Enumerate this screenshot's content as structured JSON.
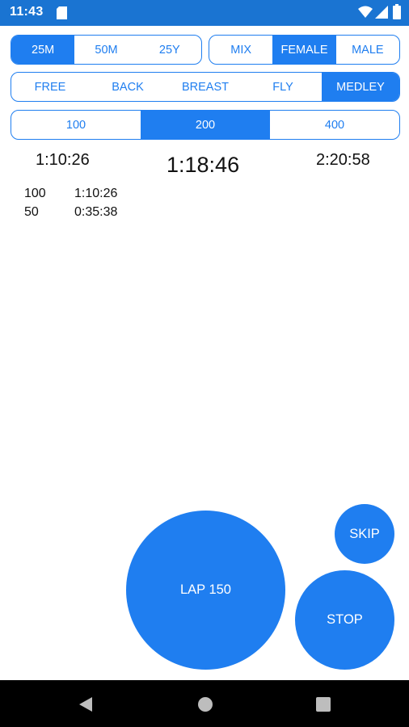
{
  "status_bar": {
    "time": "11:43",
    "icons": [
      "sd-card-icon",
      "wifi-icon",
      "signal-icon",
      "battery-icon"
    ]
  },
  "pool": {
    "options": [
      "25M",
      "50M",
      "25Y"
    ],
    "selected": "25M"
  },
  "gender": {
    "options": [
      "MIX",
      "FEMALE",
      "MALE"
    ],
    "selected": "FEMALE"
  },
  "stroke": {
    "options": [
      "FREE",
      "BACK",
      "BREAST",
      "FLY",
      "MEDLEY"
    ],
    "selected": "MEDLEY"
  },
  "distance": {
    "options": [
      "100",
      "200",
      "400"
    ],
    "selected": "200"
  },
  "times": {
    "left": "1:10:26",
    "main": "1:18:46",
    "right": "2:20:58"
  },
  "splits": [
    {
      "distance": "100",
      "time": "1:10:26"
    },
    {
      "distance": "50",
      "time": "0:35:38"
    }
  ],
  "buttons": {
    "lap": "LAP 150",
    "skip": "SKIP",
    "stop": "STOP"
  },
  "colors": {
    "accent": "#1f7ef0",
    "status_bar": "#1a74d2",
    "nav_bar": "#000000"
  }
}
